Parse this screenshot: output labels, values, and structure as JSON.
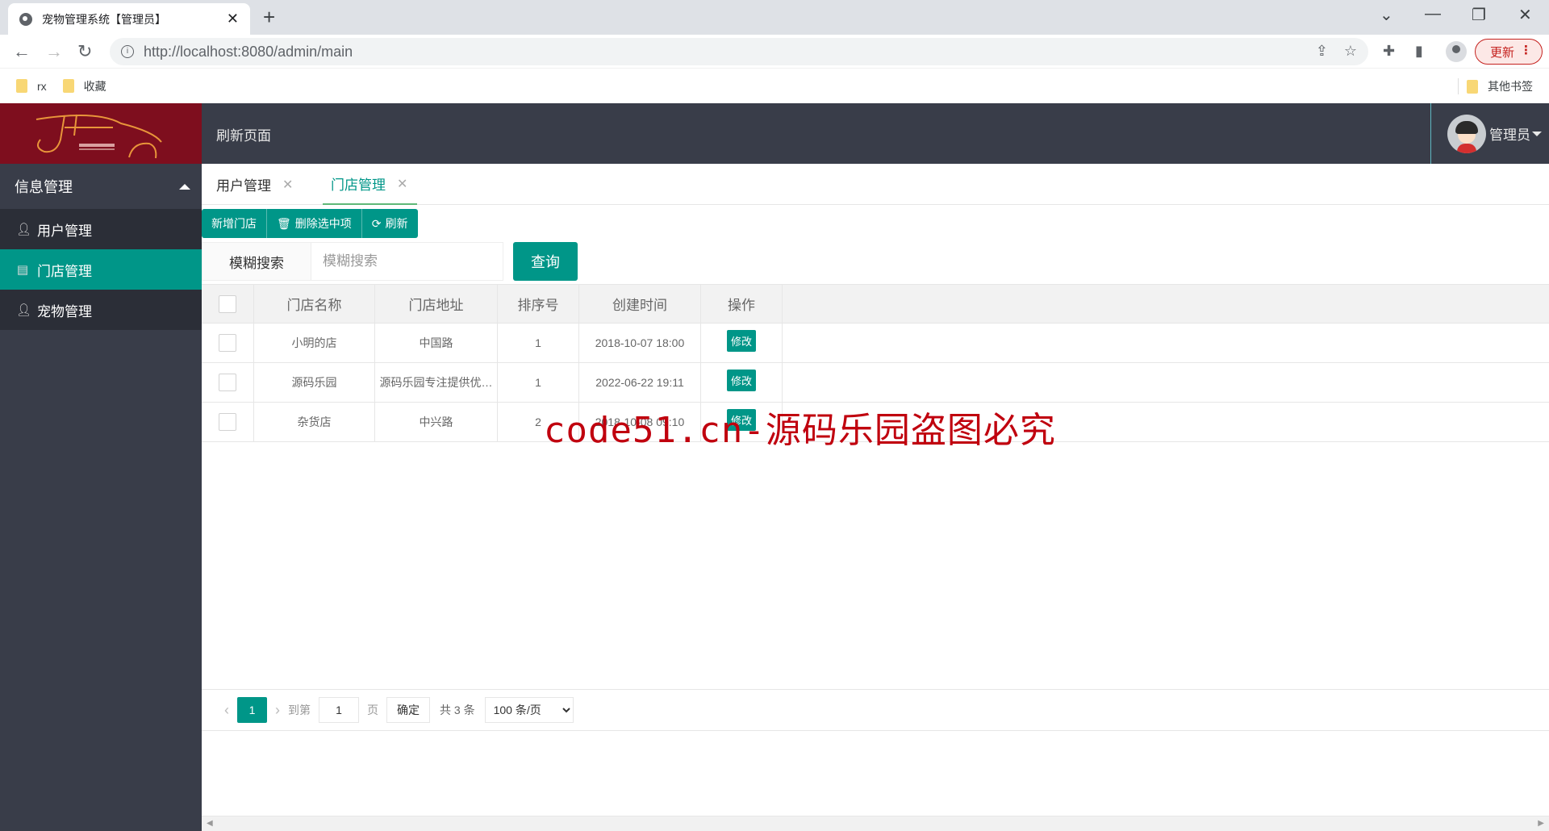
{
  "browser": {
    "tab_title": "宠物管理系统【管理员】",
    "url_host": "http://localhost",
    "url_path": ":8080/admin/main",
    "update_label": "更新",
    "bookmarks": [
      {
        "label": "rx"
      },
      {
        "label": "收藏"
      }
    ],
    "other_bookmarks": "其他书签"
  },
  "header": {
    "refresh_label": "刷新页面",
    "user_name": "管理员"
  },
  "sidebar": {
    "group_label": "信息管理",
    "items": [
      {
        "label": "用户管理",
        "icon": "user-icon",
        "active": false
      },
      {
        "label": "门店管理",
        "icon": "clipboard-icon",
        "active": true
      },
      {
        "label": "宠物管理",
        "icon": "user-icon",
        "active": false
      }
    ]
  },
  "tabs": [
    {
      "label": "用户管理",
      "active": false
    },
    {
      "label": "门店管理",
      "active": true
    }
  ],
  "toolbar": {
    "add_label": "新增门店",
    "delete_label": "删除选中项",
    "refresh_label": "刷新"
  },
  "search": {
    "label": "模糊搜索",
    "placeholder": "模糊搜索",
    "value": "",
    "query_label": "查询"
  },
  "table": {
    "columns": [
      "门店名称",
      "门店地址",
      "排序号",
      "创建时间",
      "操作"
    ],
    "rows": [
      {
        "name": "小明的店",
        "address": "中国路",
        "order": "1",
        "created": "2018-10-07 18:00",
        "action": "修改"
      },
      {
        "name": "源码乐园",
        "address": "源码乐园专注提供优…",
        "order": "1",
        "created": "2022-06-22 19:11",
        "action": "修改"
      },
      {
        "name": "杂货店",
        "address": "中兴路",
        "order": "2",
        "created": "2018-10-08 09:10",
        "action": "修改"
      }
    ]
  },
  "pagination": {
    "current_page": "1",
    "goto_label": "到第",
    "goto_value": "1",
    "page_unit": "页",
    "confirm_label": "确定",
    "total_label": "共 3 条",
    "page_size": "100 条/页"
  },
  "watermark": "code51.cn-源码乐园盗图必究"
}
